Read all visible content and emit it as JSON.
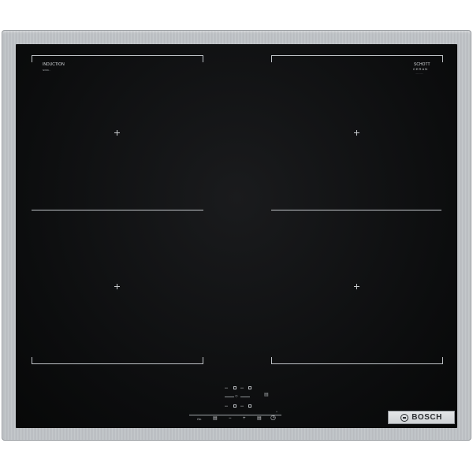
{
  "brand": {
    "label": "BOSCH"
  },
  "glass": {
    "label": "INDUCTION",
    "sublabel": "NXS6...",
    "maker": "SCHOTT",
    "maker_line2": "CERAN",
    "maker_code": "............"
  },
  "controls": {
    "zone_labels": [
      "•••• ",
      "•••• ",
      "•••• ",
      "•••• "
    ],
    "power": "On",
    "minus": "−",
    "plus": "+",
    "timer_icon": "clock-icon"
  }
}
